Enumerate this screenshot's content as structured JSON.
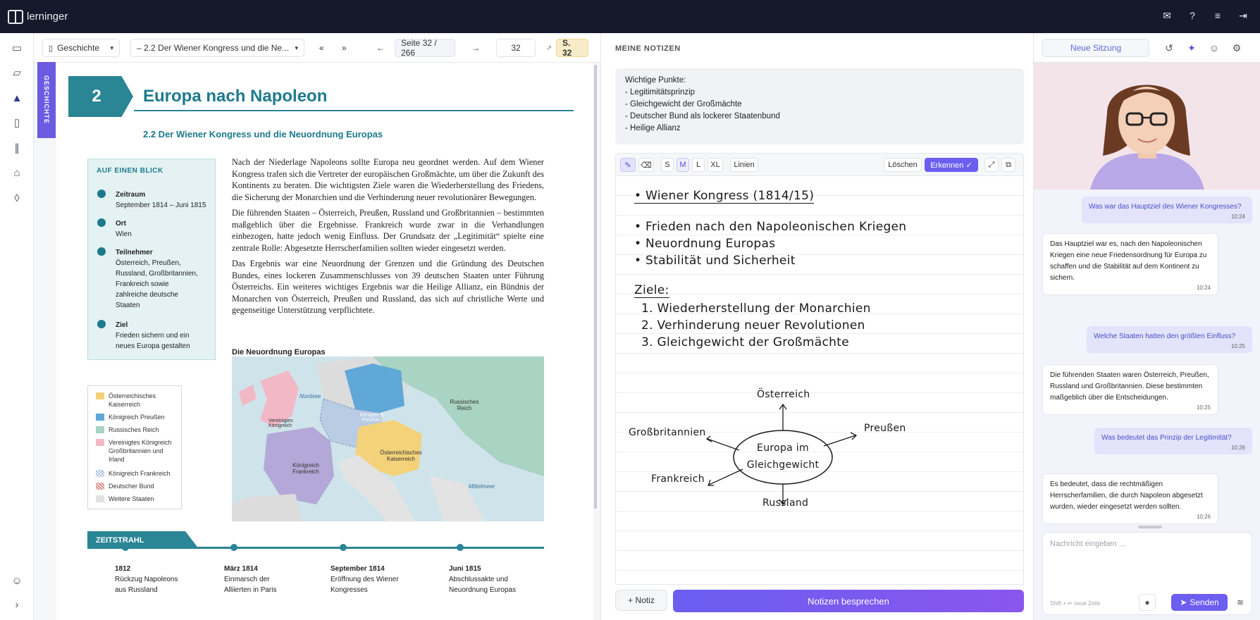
{
  "app": {
    "name": "lerninger"
  },
  "topbar": {
    "icons": [
      "mail-icon",
      "help-icon",
      "sliders-icon",
      "logout-icon"
    ]
  },
  "rail": {
    "icons": [
      "presentation-icon",
      "folder-icon",
      "graduation-cap-icon",
      "book-icon",
      "library-icon",
      "store-icon",
      "shield-icon",
      "user-icon",
      "chevron-right-icon"
    ]
  },
  "toolbar": {
    "subject": "Geschichte",
    "chapter": "– 2.2 Der Wiener Kongress und die Ne...",
    "first": "«",
    "last": "»",
    "prev": "←",
    "page_label": "Seite 32 / 266",
    "next": "→",
    "page_input": "32",
    "page_badge": "S. 32"
  },
  "book": {
    "bookmark": "GESCHICHTE",
    "chapter_number": "2",
    "chapter_title": "Europa nach Napoleon",
    "section_title": "2.2   Der Wiener Kongress und die Neuordnung Europas",
    "glance": {
      "heading": "AUF EINEN BLICK",
      "items": [
        {
          "title": "Zeitraum",
          "value": "September 1814 – Juni 1815"
        },
        {
          "title": "Ort",
          "value": "Wien"
        },
        {
          "title": "Teilnehmer",
          "value": "Österreich, Preußen, Russland, Großbritannien, Frankreich sowie zahlreiche deutsche Staaten"
        },
        {
          "title": "Ziel",
          "value": "Frieden sichern und ein neues Europa gestalten"
        }
      ]
    },
    "paragraphs": [
      "Nach der Niederlage Napoleons sollte Europa neu geordnet werden. Auf dem Wiener Kongress trafen sich die Vertreter der europäischen Großmächte, um über die Zukunft des Kontinents zu beraten. Die wichtigsten Ziele waren die Wiederherstellung des Friedens, die Sicherung der Monarchien und die Verhinderung neuer revolutionärer Bewegungen.",
      "Die führenden Staaten – Österreich, Preußen, Russland und Großbritannien – bestimmten maßgeblich über die Ergebnisse. Frankreich wurde zwar in die Verhandlungen einbezogen, hatte jedoch wenig Einfluss. Der Grundsatz der „Legitimität“ spielte eine zentrale Rolle: Abgesetzte Herrscherfamilien sollten wieder eingesetzt werden.",
      "Das Ergebnis war eine Neuordnung der Grenzen und die Gründung des Deutschen Bundes, eines lockeren Zusammenschlusses von 39 deutschen Staaten unter Führung Österreichs. Ein weiteres wichtiges Ergebnis war die Heilige Allianz, ein Bündnis der Monarchen von Österreich, Preußen und Russland, das sich auf christliche Werte und gegenseitige Unterstützung verpflichtete."
    ],
    "map_title": "Die Neuordnung Europas",
    "map_labels": {
      "nordsee": "Nordsee",
      "russland": "Russisches Reich",
      "preussen": "Königreich Preußen",
      "grossbritannien": "Vereinigtes Königreich",
      "frankreich": "Königreich Frankreich",
      "oesterreich": "Österreichisches Kaiserreich",
      "mittelmeer": "Mittelmeer"
    },
    "legend": [
      {
        "label": "Österreichisches Kaiserreich",
        "color": "#f3d27a"
      },
      {
        "label": "Königreich Preußen",
        "color": "#5fa8d8"
      },
      {
        "label": "Russisches Reich",
        "color": "#a9d3c3"
      },
      {
        "label": "Vereinigtes Königreich Großbritannien und Irland",
        "color": "#f2b8c6"
      },
      {
        "label": "Königreich Frankreich",
        "color": "#b8cce4"
      },
      {
        "label": "Deutscher Bund",
        "color": "#e9a9a9"
      },
      {
        "label": "Weitere Staaten",
        "color": "#e3e3e3"
      }
    ],
    "timeline_title": "ZEITSTRAHL",
    "timeline": [
      {
        "date": "1812",
        "text": "Rückzug Napoleons aus Russland"
      },
      {
        "date": "März 1814",
        "text": "Einmarsch der Alliierten in Paris"
      },
      {
        "date": "September 1814",
        "text": "Eröffnung des Wiener Kongresses"
      },
      {
        "date": "Juni 1815",
        "text": "Abschlussakte und Neuordnung Europas"
      }
    ]
  },
  "notes": {
    "title": "MEINE NOTIZEN",
    "key_points": [
      "Wichtige Punkte:",
      "- Legitimitätsprinzip",
      "- Gleichgewicht der Großmächte",
      "- Deutscher Bund als lockerer Staatenbund",
      "- Heilige Allianz"
    ],
    "pen_tools": {
      "pen": "pen-icon",
      "eraser": "eraser-icon",
      "sizes": [
        "S",
        "M",
        "L",
        "XL"
      ],
      "lines": "Linien",
      "delete": "Löschen",
      "recognize": "Erkennen ✓"
    },
    "handwriting": {
      "heading": "• Wiener Kongress (1814/15)",
      "bullets": [
        "• Frieden nach den Napoleonischen Kriegen",
        "• Neuordnung Europas",
        "• Stabilität und Sicherheit"
      ],
      "goals_heading": "Ziele:",
      "goals": [
        "1.  Wiederherstellung der Monarchien",
        "2.  Verhinderung neuer Revolutionen",
        "3.  Gleichgewicht der Großmächte"
      ],
      "diagram": {
        "center": [
          "Europa im",
          "Gleichgewicht"
        ],
        "top": "Österreich",
        "right": "Preußen",
        "left": "Großbritannien",
        "bottom_left": "Frankreich",
        "bottom": "Russland"
      }
    },
    "add_note": "+ Notiz",
    "discuss": "Notizen besprechen"
  },
  "chat": {
    "new_session": "Neue Sitzung",
    "messages": [
      {
        "role": "user",
        "text": "Was war das Hauptziel des Wiener Kongresses?",
        "time": "10:24"
      },
      {
        "role": "bot",
        "text": "Das Hauptziel war es, nach den Napoleonischen Kriegen eine neue Friedensordnung für Europa zu schaffen und die Stabilität auf dem Kontinent zu sichern.",
        "time": "10:24"
      },
      {
        "role": "user",
        "text": "Welche Staaten hatten den größten Einfluss?",
        "time": "10:25"
      },
      {
        "role": "bot",
        "text": "Die führenden Staaten waren Österreich, Preußen, Russland und Großbritannien. Diese bestimmten maßgeblich über die Entscheidungen.",
        "time": "10:25"
      },
      {
        "role": "user",
        "text": "Was bedeutet das Prinzip der Legitimität?",
        "time": "10:26"
      },
      {
        "role": "bot",
        "text": "Es bedeutet, dass die rechtmäßigen Herrscherfamilien, die durch Napoleon abgesetzt wurden, wieder eingesetzt werden sollten.",
        "time": "10:26"
      }
    ],
    "input_placeholder": "Nachricht eingeben ...",
    "hint": "Shift + ↵ neue Zeile",
    "send": "Senden"
  }
}
